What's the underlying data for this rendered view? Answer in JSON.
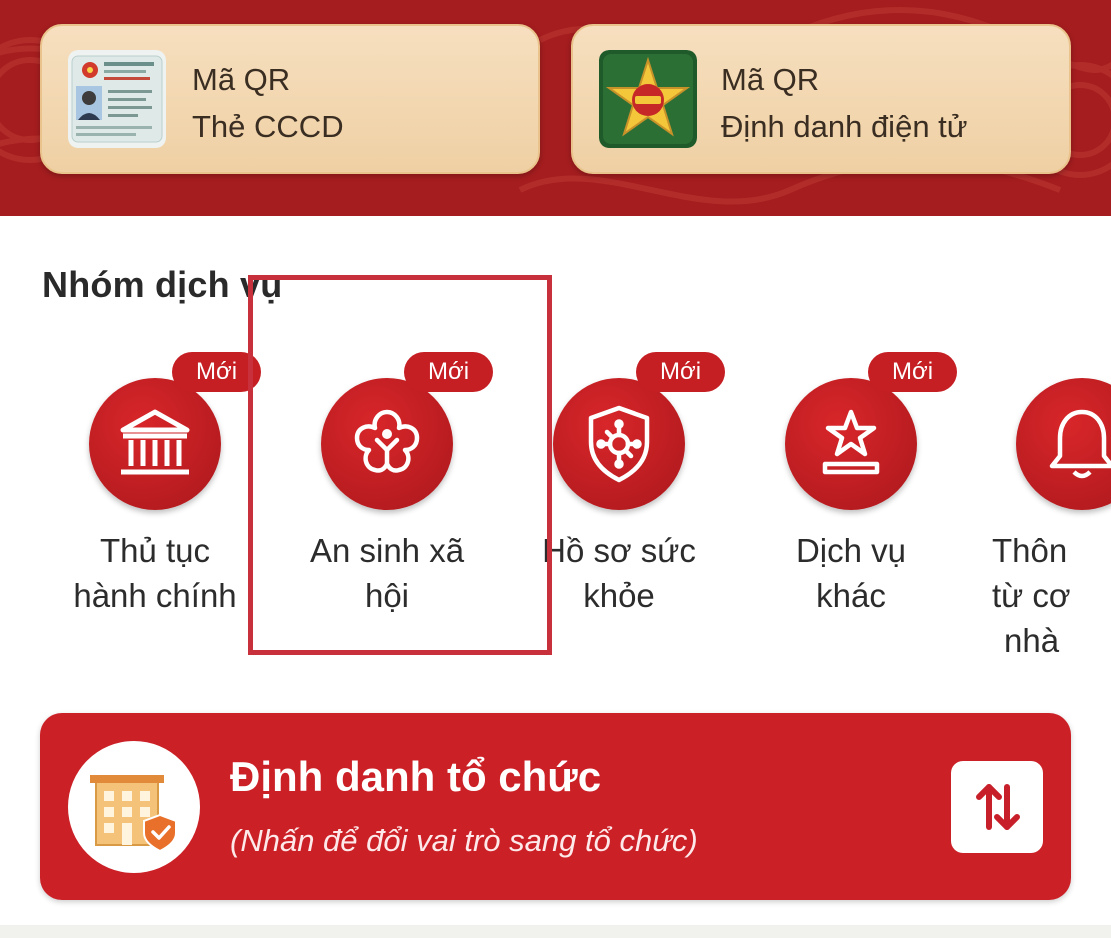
{
  "qr_cards": [
    {
      "line1": "Mã QR",
      "line2": "Thẻ CCCD",
      "icon": "id-card-icon"
    },
    {
      "line1": "Mã QR",
      "line2": "Định danh điện tử",
      "icon": "vneid-emblem-icon"
    }
  ],
  "service_group": {
    "title": "Nhóm dịch vụ",
    "items": [
      {
        "line1": "Thủ tục",
        "line2": "hành chính",
        "line3": "",
        "badge": "Mới",
        "icon": "government-building-icon"
      },
      {
        "line1": "An sinh xã",
        "line2": "hội",
        "line3": "",
        "badge": "Mới",
        "icon": "social-welfare-flower-icon"
      },
      {
        "line1": "Hồ sơ sức",
        "line2": "khỏe",
        "line3": "",
        "badge": "Mới",
        "icon": "health-shield-virus-icon"
      },
      {
        "line1": "Dịch vụ",
        "line2": "khác",
        "line3": "",
        "badge": "Mới",
        "icon": "star-podium-icon"
      },
      {
        "line1": "Thôn",
        "line2": "từ cơ",
        "line3": "nhà",
        "badge": "",
        "icon": "bell-icon"
      }
    ]
  },
  "org_banner": {
    "title": "Định danh tổ chức",
    "subtitle": "(Nhấn để đổi vai trò sang tổ chức)",
    "icon": "organization-building-icon",
    "switch_icon": "swap-arrows-icon"
  },
  "colors": {
    "primary_red": "#cc2027",
    "banner_red": "#a51d1f",
    "card_beige": "#f3d8b3",
    "highlight_border": "#c8303b"
  }
}
